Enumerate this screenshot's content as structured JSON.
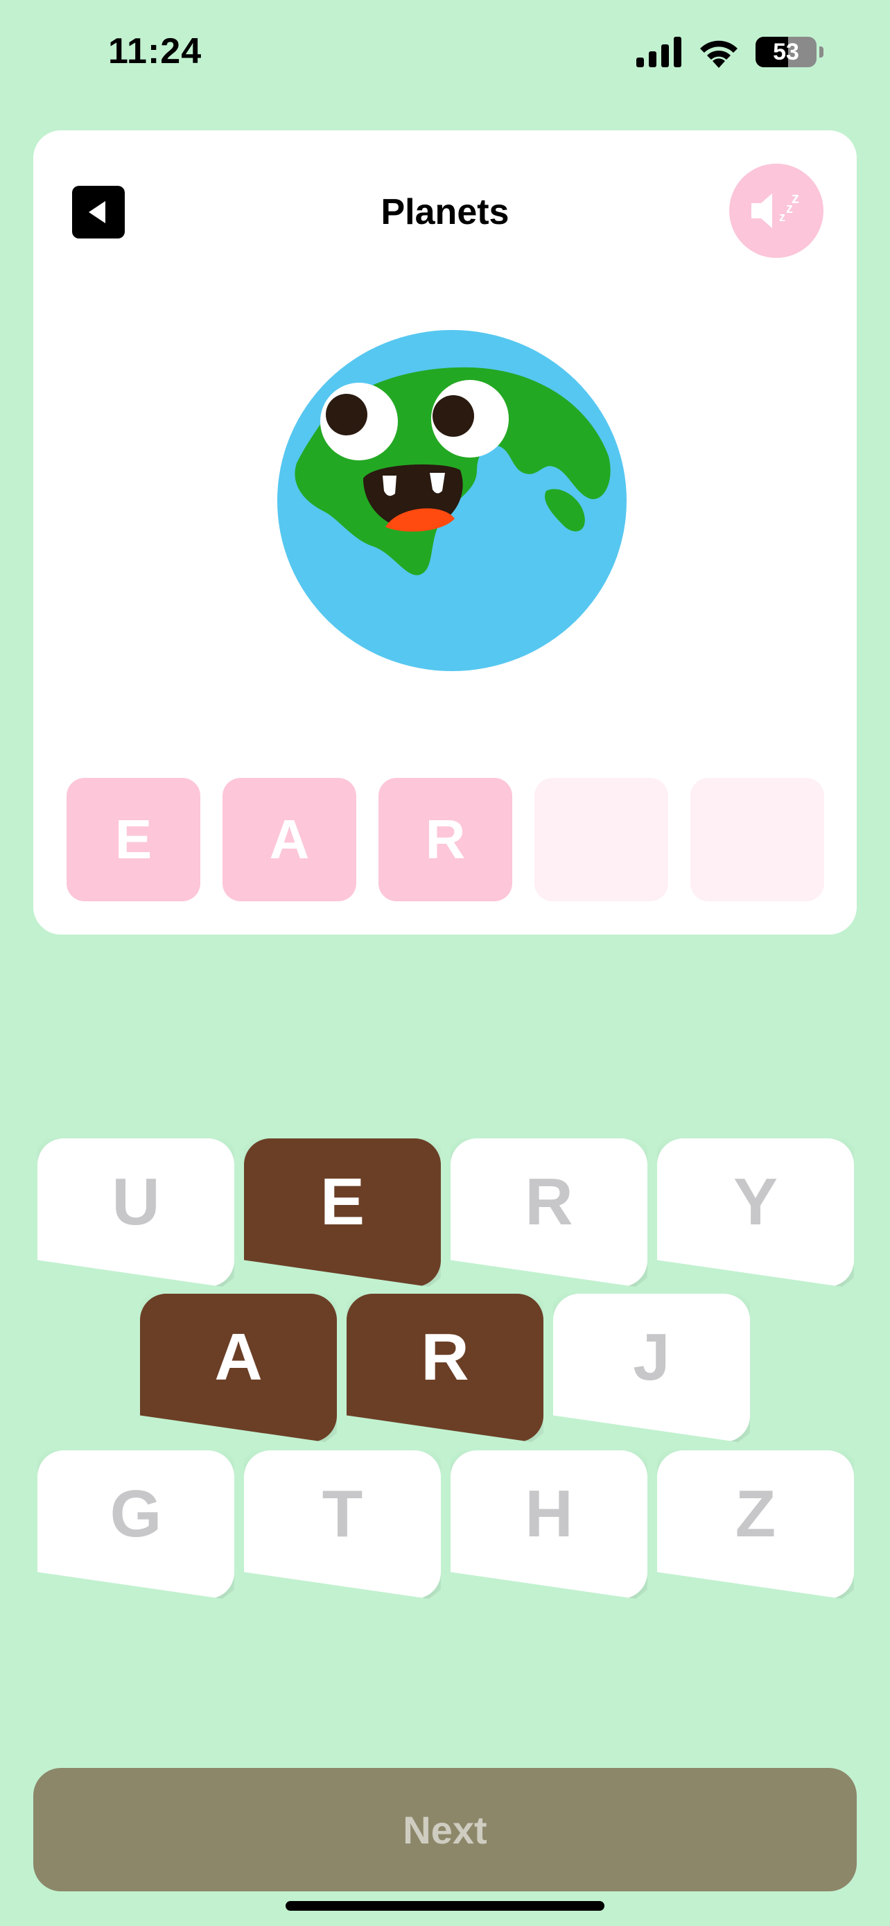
{
  "status_bar": {
    "time": "11:24",
    "battery": "53",
    "battery_level": 0.53
  },
  "header": {
    "title": "Planets",
    "back_icon": "back-arrow-icon",
    "sound_icon": "speaker-muted-icon"
  },
  "illustration": {
    "name": "earth-cartoon"
  },
  "answer_slots": [
    {
      "letter": "E",
      "filled": true
    },
    {
      "letter": "A",
      "filled": true
    },
    {
      "letter": "R",
      "filled": true
    },
    {
      "letter": "",
      "filled": false
    },
    {
      "letter": "",
      "filled": false
    }
  ],
  "keyboard": {
    "row1": [
      {
        "letter": "U",
        "selected": false
      },
      {
        "letter": "E",
        "selected": true
      },
      {
        "letter": "R",
        "selected": false
      },
      {
        "letter": "Y",
        "selected": false
      }
    ],
    "row2": [
      {
        "letter": "A",
        "selected": true
      },
      {
        "letter": "R",
        "selected": true
      },
      {
        "letter": "J",
        "selected": false
      }
    ],
    "row3": [
      {
        "letter": "G",
        "selected": false
      },
      {
        "letter": "T",
        "selected": false
      },
      {
        "letter": "H",
        "selected": false
      },
      {
        "letter": "Z",
        "selected": false
      }
    ]
  },
  "next_button": {
    "label": "Next",
    "enabled": false
  },
  "colors": {
    "background": "#c2f1d0",
    "slot_filled": "#fdc6d9",
    "slot_empty": "#fef0f5",
    "key_selected": "#6b3f26",
    "next_disabled": "#8d876a"
  }
}
